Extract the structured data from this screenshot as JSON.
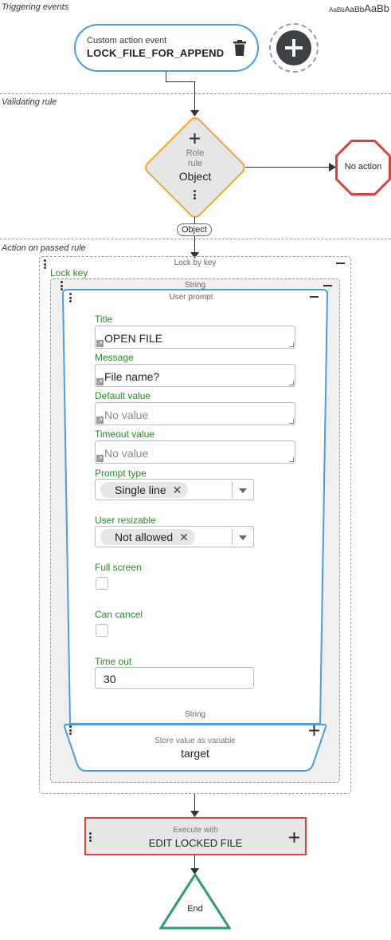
{
  "sections": {
    "triggering": "Triggering events",
    "validating": "Validating rule",
    "action": "Action on passed rule"
  },
  "font_samples": [
    "AaBb",
    "AaBb",
    "AaBb"
  ],
  "event": {
    "subtitle": "Custom action event",
    "name": "LOCK_FILE_FOR_APPEND"
  },
  "rule": {
    "line1": "Role",
    "line2": "rule",
    "type": "Object"
  },
  "no_action": "No action",
  "connector_label": "Object",
  "lock": {
    "title": "Lock by key",
    "key_label": "Lock key",
    "string_title": "String",
    "prompt": {
      "title": "User prompt",
      "fields": {
        "title_label": "Title",
        "title_value": "OPEN FILE",
        "message_label": "Message",
        "message_value": "File name?",
        "default_label": "Default value",
        "default_placeholder": "No value",
        "timeout_label": "Timeout value",
        "timeout_placeholder": "No value",
        "prompt_type_label": "Prompt type",
        "prompt_type_value": "Single line",
        "resizable_label": "User resizable",
        "resizable_value": "Not allowed",
        "fullscreen_label": "Full screen",
        "cancel_label": "Can cancel",
        "timeout_num_label": "Time out",
        "timeout_num_value": "30"
      },
      "bottom_label": "String"
    },
    "store": {
      "subtitle": "Store value as variable",
      "variable": "target"
    }
  },
  "execute": {
    "subtitle": "Execute with",
    "name": "EDIT LOCKED FILE"
  },
  "end": "End",
  "colors": {
    "blue": "#4a9fd8",
    "orange": "#f0a830",
    "red": "#d9433b",
    "green": "#2e9a6e",
    "label_green": "#2a8a2a"
  }
}
